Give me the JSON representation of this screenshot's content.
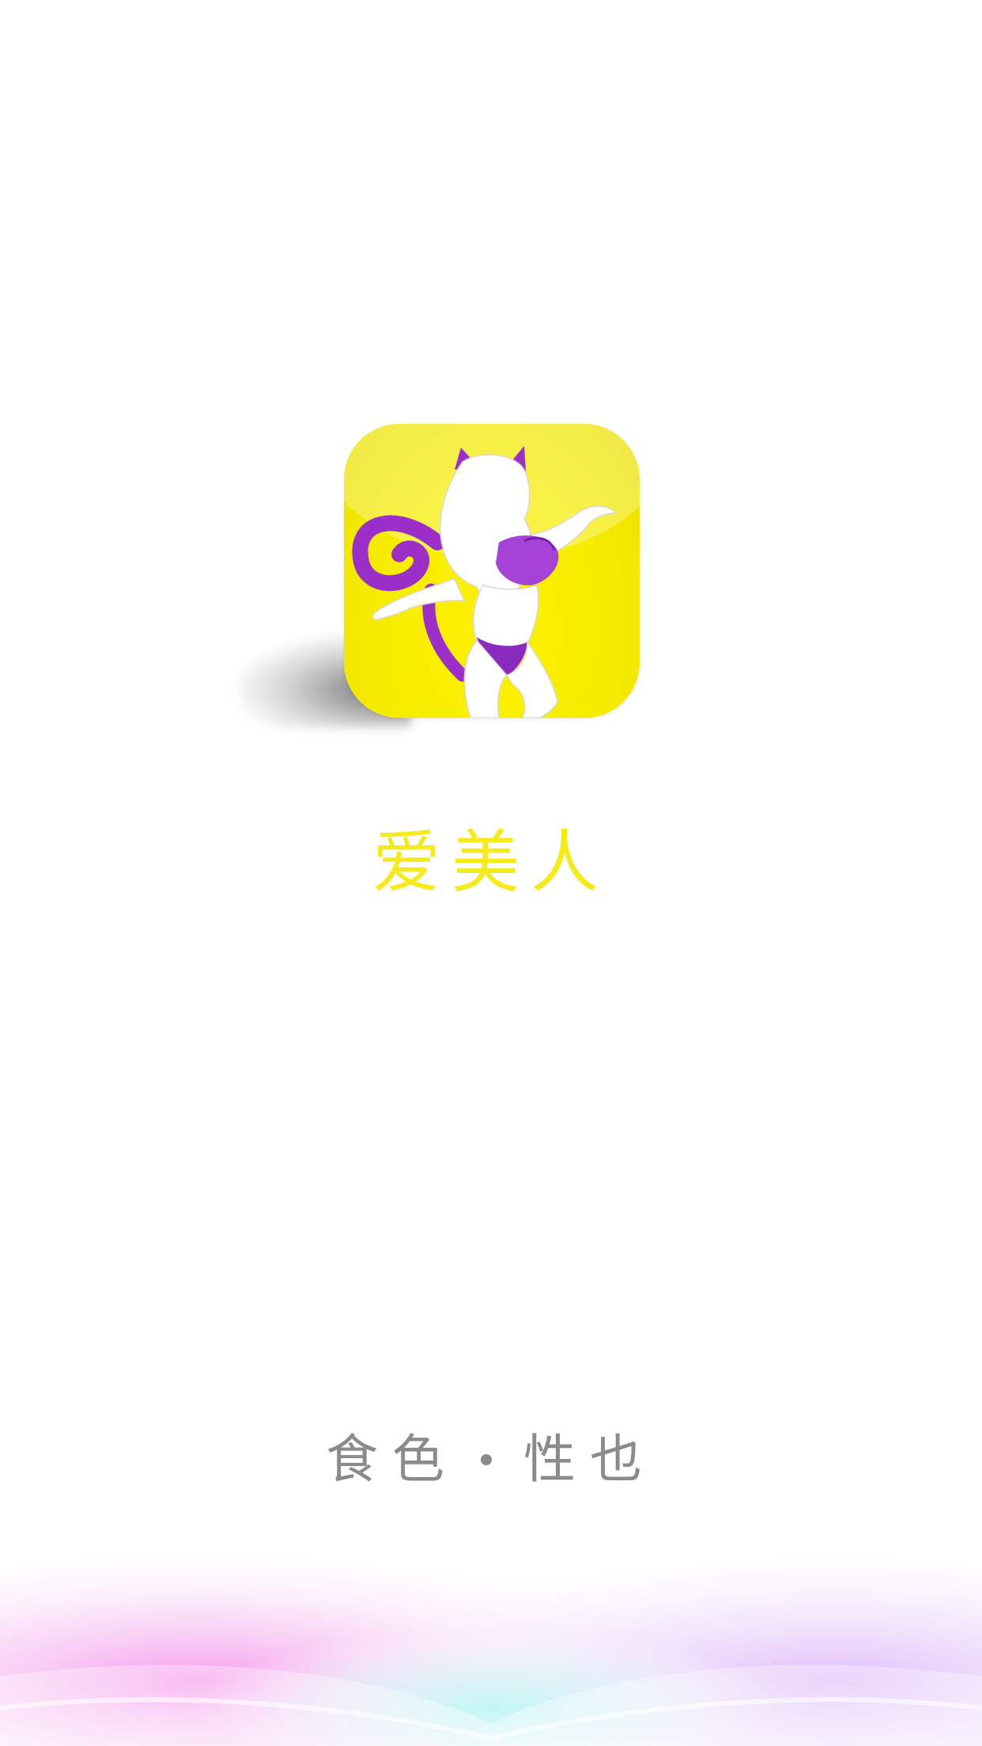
{
  "splash": {
    "app_name": "爱美人",
    "slogan_left": "食色",
    "slogan_right": "性也"
  },
  "colors": {
    "background": "#ffffff",
    "brand_yellow": "#f4ea1c",
    "icon_yellow": "#fff200",
    "accent_purple": "#9b2fc8",
    "slogan_gray": "#8b8b8b",
    "glow_pink": "#f27ae8",
    "glow_cyan": "#bff7f4"
  },
  "icons": {
    "app_icon": "cat-girl-silhouette-icon",
    "separator": "dot-separator-icon"
  }
}
